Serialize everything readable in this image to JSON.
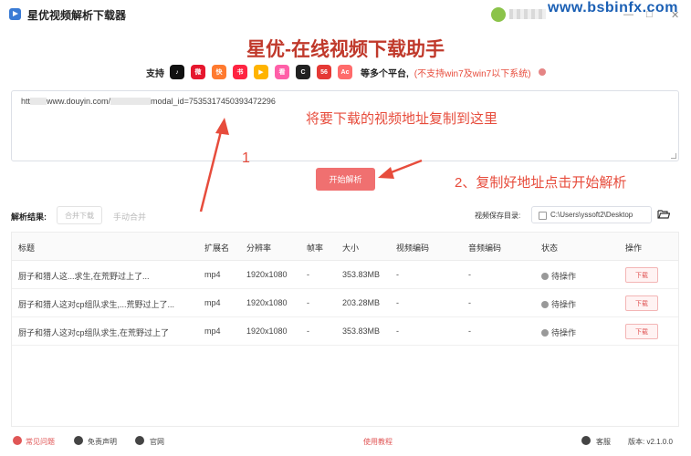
{
  "window": {
    "title": "星优视频解析下载器",
    "watermark": "www.bsbinfx.com",
    "minimize_glyph": "—",
    "maximize_glyph": "□",
    "close_glyph": "✕"
  },
  "header": {
    "main_title": "星优-在线视频下载助手",
    "support_label": "支持",
    "platforms": [
      {
        "icon": "tiktok-icon",
        "color": "#111111",
        "glyph": "♪"
      },
      {
        "icon": "weibo-icon",
        "color": "#e6162d",
        "glyph": "微"
      },
      {
        "icon": "kuaishou-icon",
        "color": "#ff7a2f",
        "glyph": "快"
      },
      {
        "icon": "xiaohongshu-icon",
        "color": "#ff2442",
        "glyph": "书"
      },
      {
        "icon": "video-play-icon",
        "color": "#ffb400",
        "glyph": "▶"
      },
      {
        "icon": "haokan-icon",
        "color": "#ff5fa8",
        "glyph": "看"
      },
      {
        "icon": "cctv-icon",
        "color": "#222222",
        "glyph": "C"
      },
      {
        "icon": "56-icon",
        "color": "#e53935",
        "glyph": "56"
      },
      {
        "icon": "acfun-icon",
        "color": "#ff6b6b",
        "glyph": "Ac"
      }
    ],
    "more_platforms": "等多个平台,",
    "win_note": "(不支持win7及win7以下系统)"
  },
  "url_input": {
    "value": "https://www.douyin.com/jingxuan?modal_id=7535317450393472296",
    "display_prefix": "htt",
    "display_mid": "www.douyin.com/",
    "display_suffix": "modal_id=7535317450393472296"
  },
  "annotations": {
    "paste_hint": "将要下载的视频地址复制到这里",
    "step1": "1",
    "step2": "2、复制好地址点击开始解析"
  },
  "actions": {
    "start_parse": "开始解析"
  },
  "results": {
    "label": "解析结果:",
    "merge_download": "合并下载",
    "manual_merge": "手动合并",
    "save_dir_label": "视频保存目录:",
    "save_dir_value": "C:\\Users\\yssoft2\\Desktop"
  },
  "table": {
    "columns": [
      "标题",
      "扩展名",
      "分辨率",
      "帧率",
      "大小",
      "视频编码",
      "音频编码",
      "状态",
      "操作"
    ],
    "rows": [
      {
        "title": "厨子和猎人这...求生,在荒野过上了...",
        "ext": "mp4",
        "resolution": "1920x1080",
        "fps": "-",
        "size": "353.83MB",
        "vcodec": "-",
        "acodec": "-",
        "status": "待操作",
        "action": "下载"
      },
      {
        "title": "厨子和猎人这对cp组队求生,...荒野过上了...",
        "ext": "mp4",
        "resolution": "1920x1080",
        "fps": "-",
        "size": "203.28MB",
        "vcodec": "-",
        "acodec": "-",
        "status": "待操作",
        "action": "下载"
      },
      {
        "title": "厨子和猎人这对cp组队求生,在荒野过上了",
        "ext": "mp4",
        "resolution": "1920x1080",
        "fps": "-",
        "size": "353.83MB",
        "vcodec": "-",
        "acodec": "-",
        "status": "待操作",
        "action": "下载"
      }
    ]
  },
  "footer": {
    "faq": "常见问题",
    "disclaimer": "免责声明",
    "website": "官网",
    "tutorial": "使用教程",
    "support": "客服",
    "version": "版本: v2.1.0.0"
  },
  "colors": {
    "accent": "#f07070",
    "title_red": "#c0392b",
    "annotation_red": "#e74c3c"
  }
}
